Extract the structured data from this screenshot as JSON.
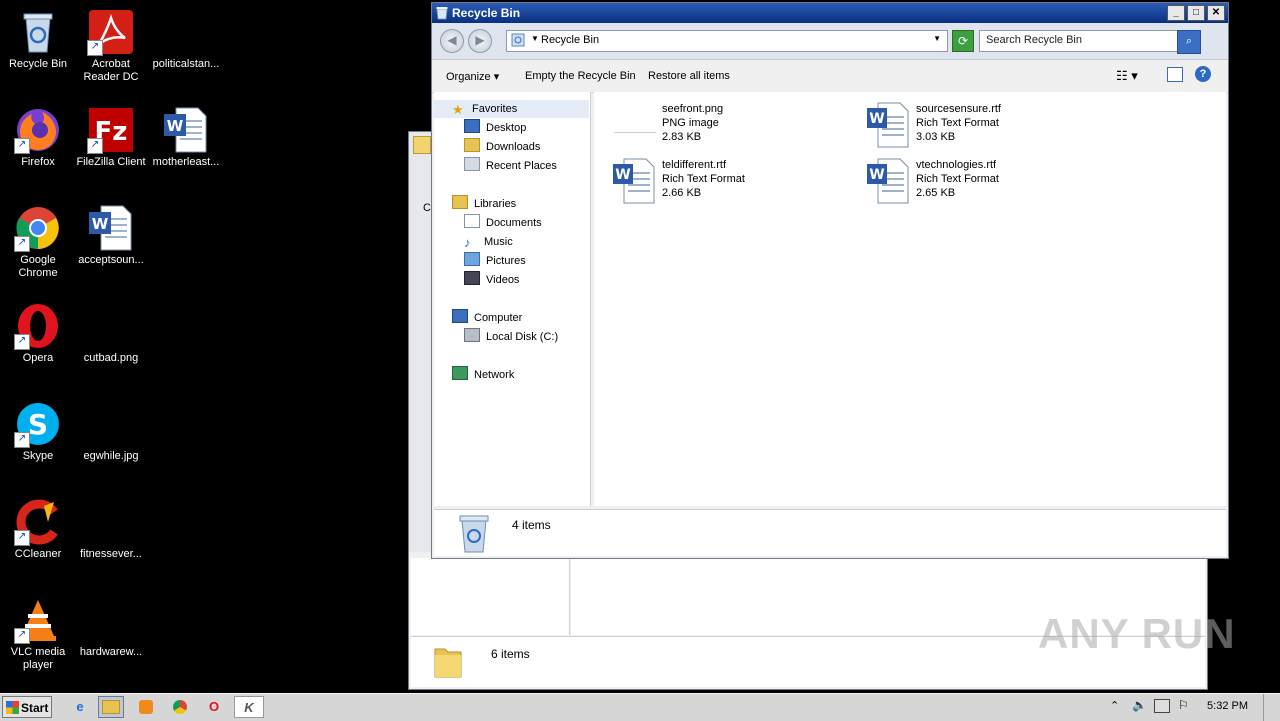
{
  "desktop_icons": [
    {
      "label": "Recycle Bin",
      "icon": "recycle-bin-icon"
    },
    {
      "label": "Acrobat Reader DC",
      "icon": "acrobat-icon"
    },
    {
      "label": "politicalstan...",
      "icon": "blank-file-icon"
    },
    {
      "label": "Firefox",
      "icon": "firefox-icon"
    },
    {
      "label": "FileZilla Client",
      "icon": "filezilla-icon"
    },
    {
      "label": "motherleast...",
      "icon": "word-doc-icon"
    },
    {
      "label": "Google Chrome",
      "icon": "chrome-icon"
    },
    {
      "label": "acceptsoun...",
      "icon": "word-doc-icon"
    },
    {
      "label": "Opera",
      "icon": "opera-icon"
    },
    {
      "label": "cutbad.png",
      "icon": "blank-file-icon"
    },
    {
      "label": "Skype",
      "icon": "skype-icon"
    },
    {
      "label": "egwhile.jpg",
      "icon": "blank-file-icon"
    },
    {
      "label": "CCleaner",
      "icon": "ccleaner-icon"
    },
    {
      "label": "fitnessever...",
      "icon": "blank-file-icon"
    },
    {
      "label": "VLC media player",
      "icon": "vlc-icon"
    },
    {
      "label": "hardwarew...",
      "icon": "blank-file-icon"
    }
  ],
  "window": {
    "title": "Recycle Bin",
    "address": "Recycle Bin",
    "search_placeholder": "Search Recycle Bin",
    "commands": {
      "organize": "Organize",
      "empty": "Empty the Recycle Bin",
      "restore": "Restore all items"
    },
    "nav": {
      "favorites": "Favorites",
      "desktop": "Desktop",
      "downloads": "Downloads",
      "recent": "Recent Places",
      "libraries": "Libraries",
      "documents": "Documents",
      "music": "Music",
      "pictures": "Pictures",
      "videos": "Videos",
      "computer": "Computer",
      "local_disk": "Local Disk (C:)",
      "network": "Network"
    },
    "files": [
      {
        "name": "seefront.png",
        "type": "PNG image",
        "size": "2.83 KB",
        "icon": "png-thumb-icon"
      },
      {
        "name": "sourcesensure.rtf",
        "type": "Rich Text Format",
        "size": "3.03 KB",
        "icon": "rtf-doc-icon"
      },
      {
        "name": "teldifferent.rtf",
        "type": "Rich Text Format",
        "size": "2.66 KB",
        "icon": "rtf-doc-icon"
      },
      {
        "name": "vtechnologies.rtf",
        "type": "Rich Text Format",
        "size": "2.65 KB",
        "icon": "rtf-doc-icon"
      }
    ],
    "status_count": "4 items"
  },
  "back_window": {
    "status_count": "6 items",
    "cmd_letter": "C"
  },
  "taskbar": {
    "start_label": "Start",
    "clock": "5:32 PM"
  },
  "watermark": "ANY RUN"
}
